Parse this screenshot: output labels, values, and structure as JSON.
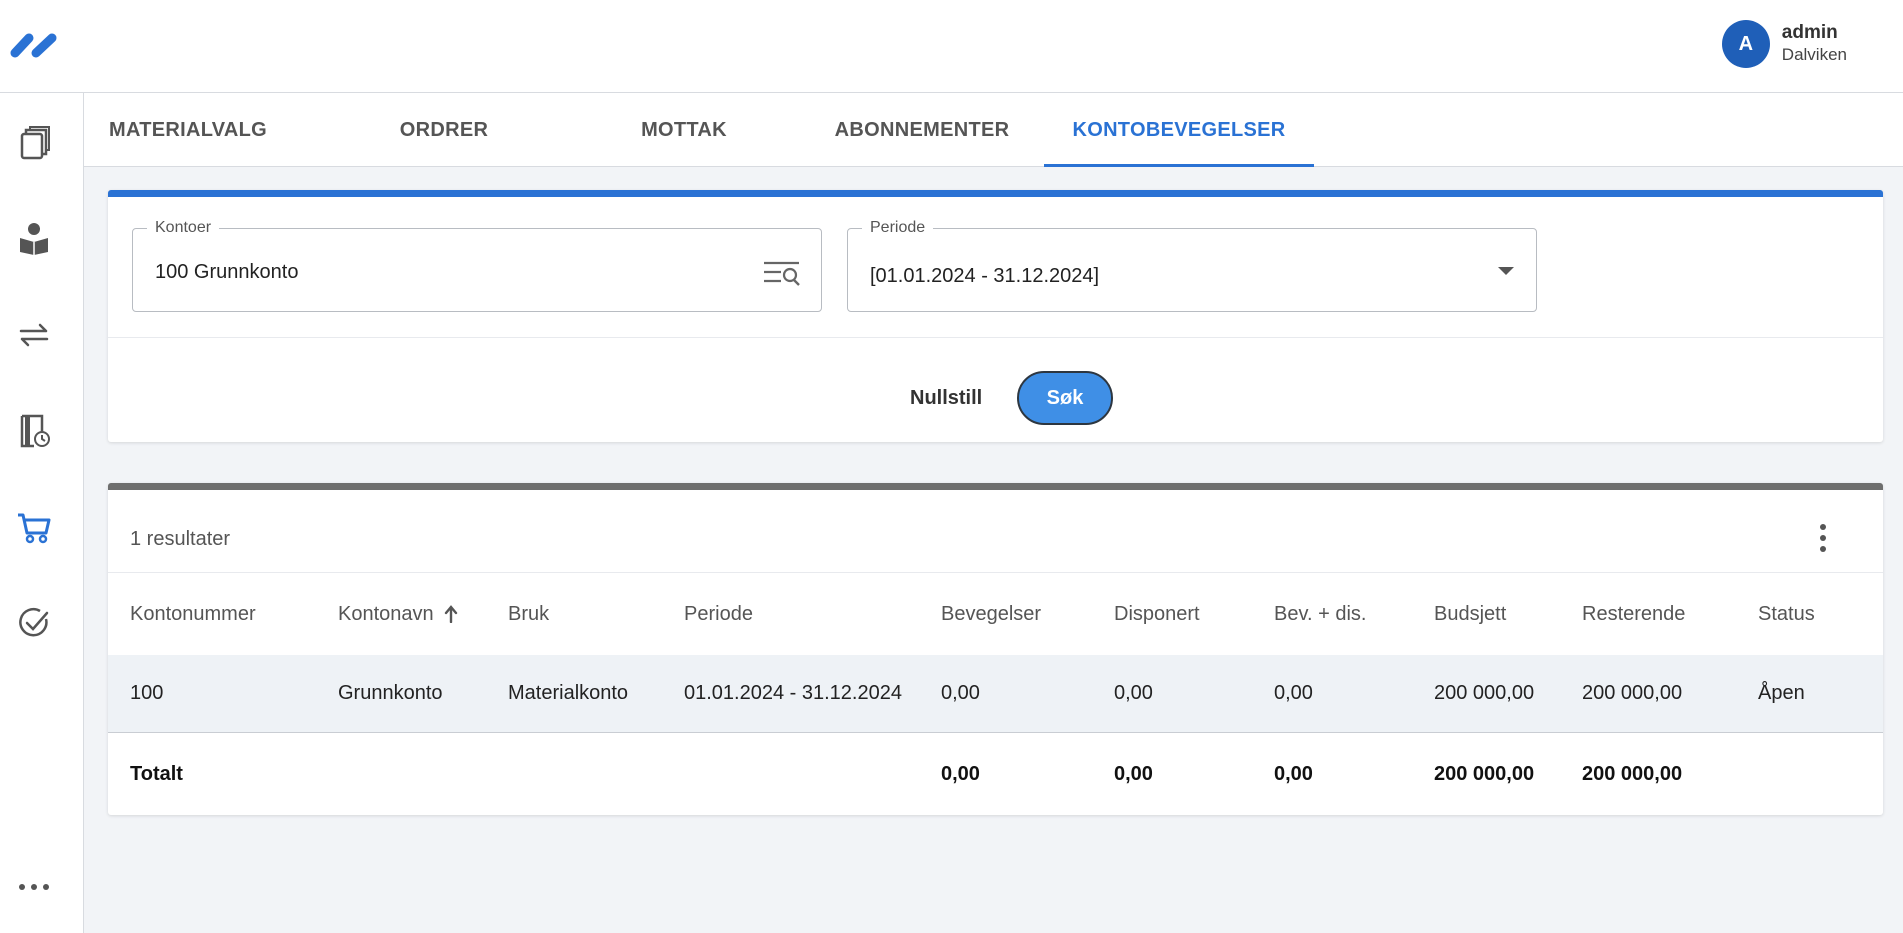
{
  "header": {
    "user": {
      "initial": "A",
      "name": "admin",
      "organization": "Dalviken"
    }
  },
  "sidebar": {
    "items": [
      {
        "icon": "books-icon"
      },
      {
        "icon": "reader-icon"
      },
      {
        "icon": "transfer-arrows-icon"
      },
      {
        "icon": "overdue-book-icon"
      },
      {
        "icon": "cart-icon",
        "active": true
      },
      {
        "icon": "check-circle-icon"
      },
      {
        "icon": "more-dots-icon"
      }
    ]
  },
  "tabs": [
    {
      "label": "MATERIALVALG"
    },
    {
      "label": "ORDRER"
    },
    {
      "label": "MOTTAK"
    },
    {
      "label": "ABONNEMENTER"
    },
    {
      "label": "KONTOBEVEGELSER",
      "active": true
    }
  ],
  "search": {
    "accounts": {
      "label": "Kontoer",
      "value": "100 Grunnkonto"
    },
    "period": {
      "label": "Periode",
      "value": "[01.01.2024 - 31.12.2024]"
    },
    "reset_label": "Nullstill",
    "search_label": "Søk"
  },
  "results": {
    "count_text": "1 resultater",
    "columns": [
      "Kontonummer",
      "Kontonavn",
      "Bruk",
      "Periode",
      "Bevegelser",
      "Disponert",
      "Bev. + dis.",
      "Budsjett",
      "Resterende",
      "Status"
    ],
    "rows": [
      [
        "100",
        "Grunnkonto",
        "Materialkonto",
        "01.01.2024 - 31.12.2024",
        "0,00",
        "0,00",
        "0,00",
        "200 000,00",
        "200 000,00",
        "Åpen"
      ]
    ],
    "totals": {
      "label": "Totalt",
      "bevegelser": "0,00",
      "disponert": "0,00",
      "bev_dis": "0,00",
      "budsjett": "200 000,00",
      "resterende": "200 000,00"
    }
  },
  "colors": {
    "accent": "#2a72d4",
    "button": "#3f8fe6",
    "avatar": "#1f5fb8"
  }
}
